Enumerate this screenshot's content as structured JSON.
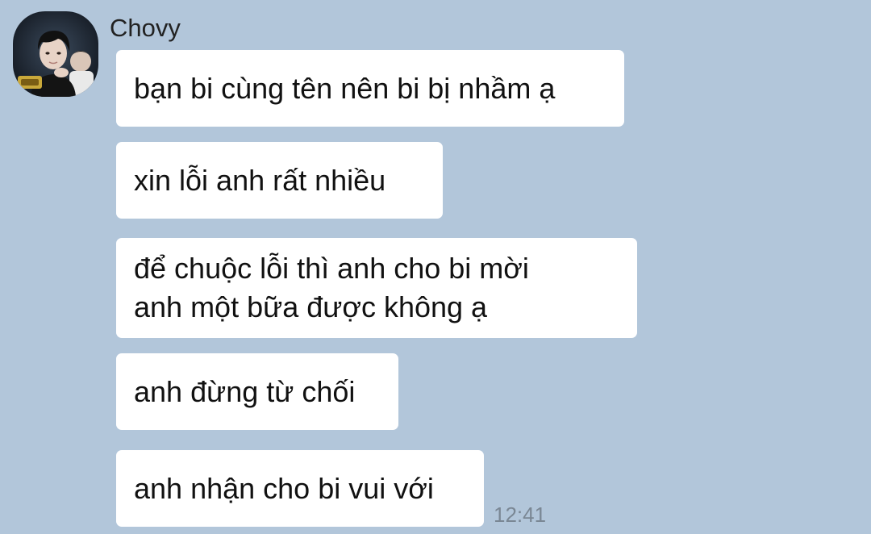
{
  "chat": {
    "sender": {
      "name": "Chovy",
      "avatar_icon": "profile-photo"
    },
    "messages": [
      {
        "text": "bạn bi cùng tên nên bi bị nhầm ạ"
      },
      {
        "text": "xin lỗi anh rất nhiều"
      },
      {
        "text": "để chuộc lỗi thì anh cho bi mời\nanh một bữa được không ạ"
      },
      {
        "text": "anh đừng từ chối"
      },
      {
        "text": "anh nhận cho bi vui với"
      }
    ],
    "timestamp": "12:41"
  },
  "colors": {
    "background": "#b2c6da",
    "bubble": "#ffffff",
    "text": "#111111",
    "timestamp": "#7a8794"
  }
}
